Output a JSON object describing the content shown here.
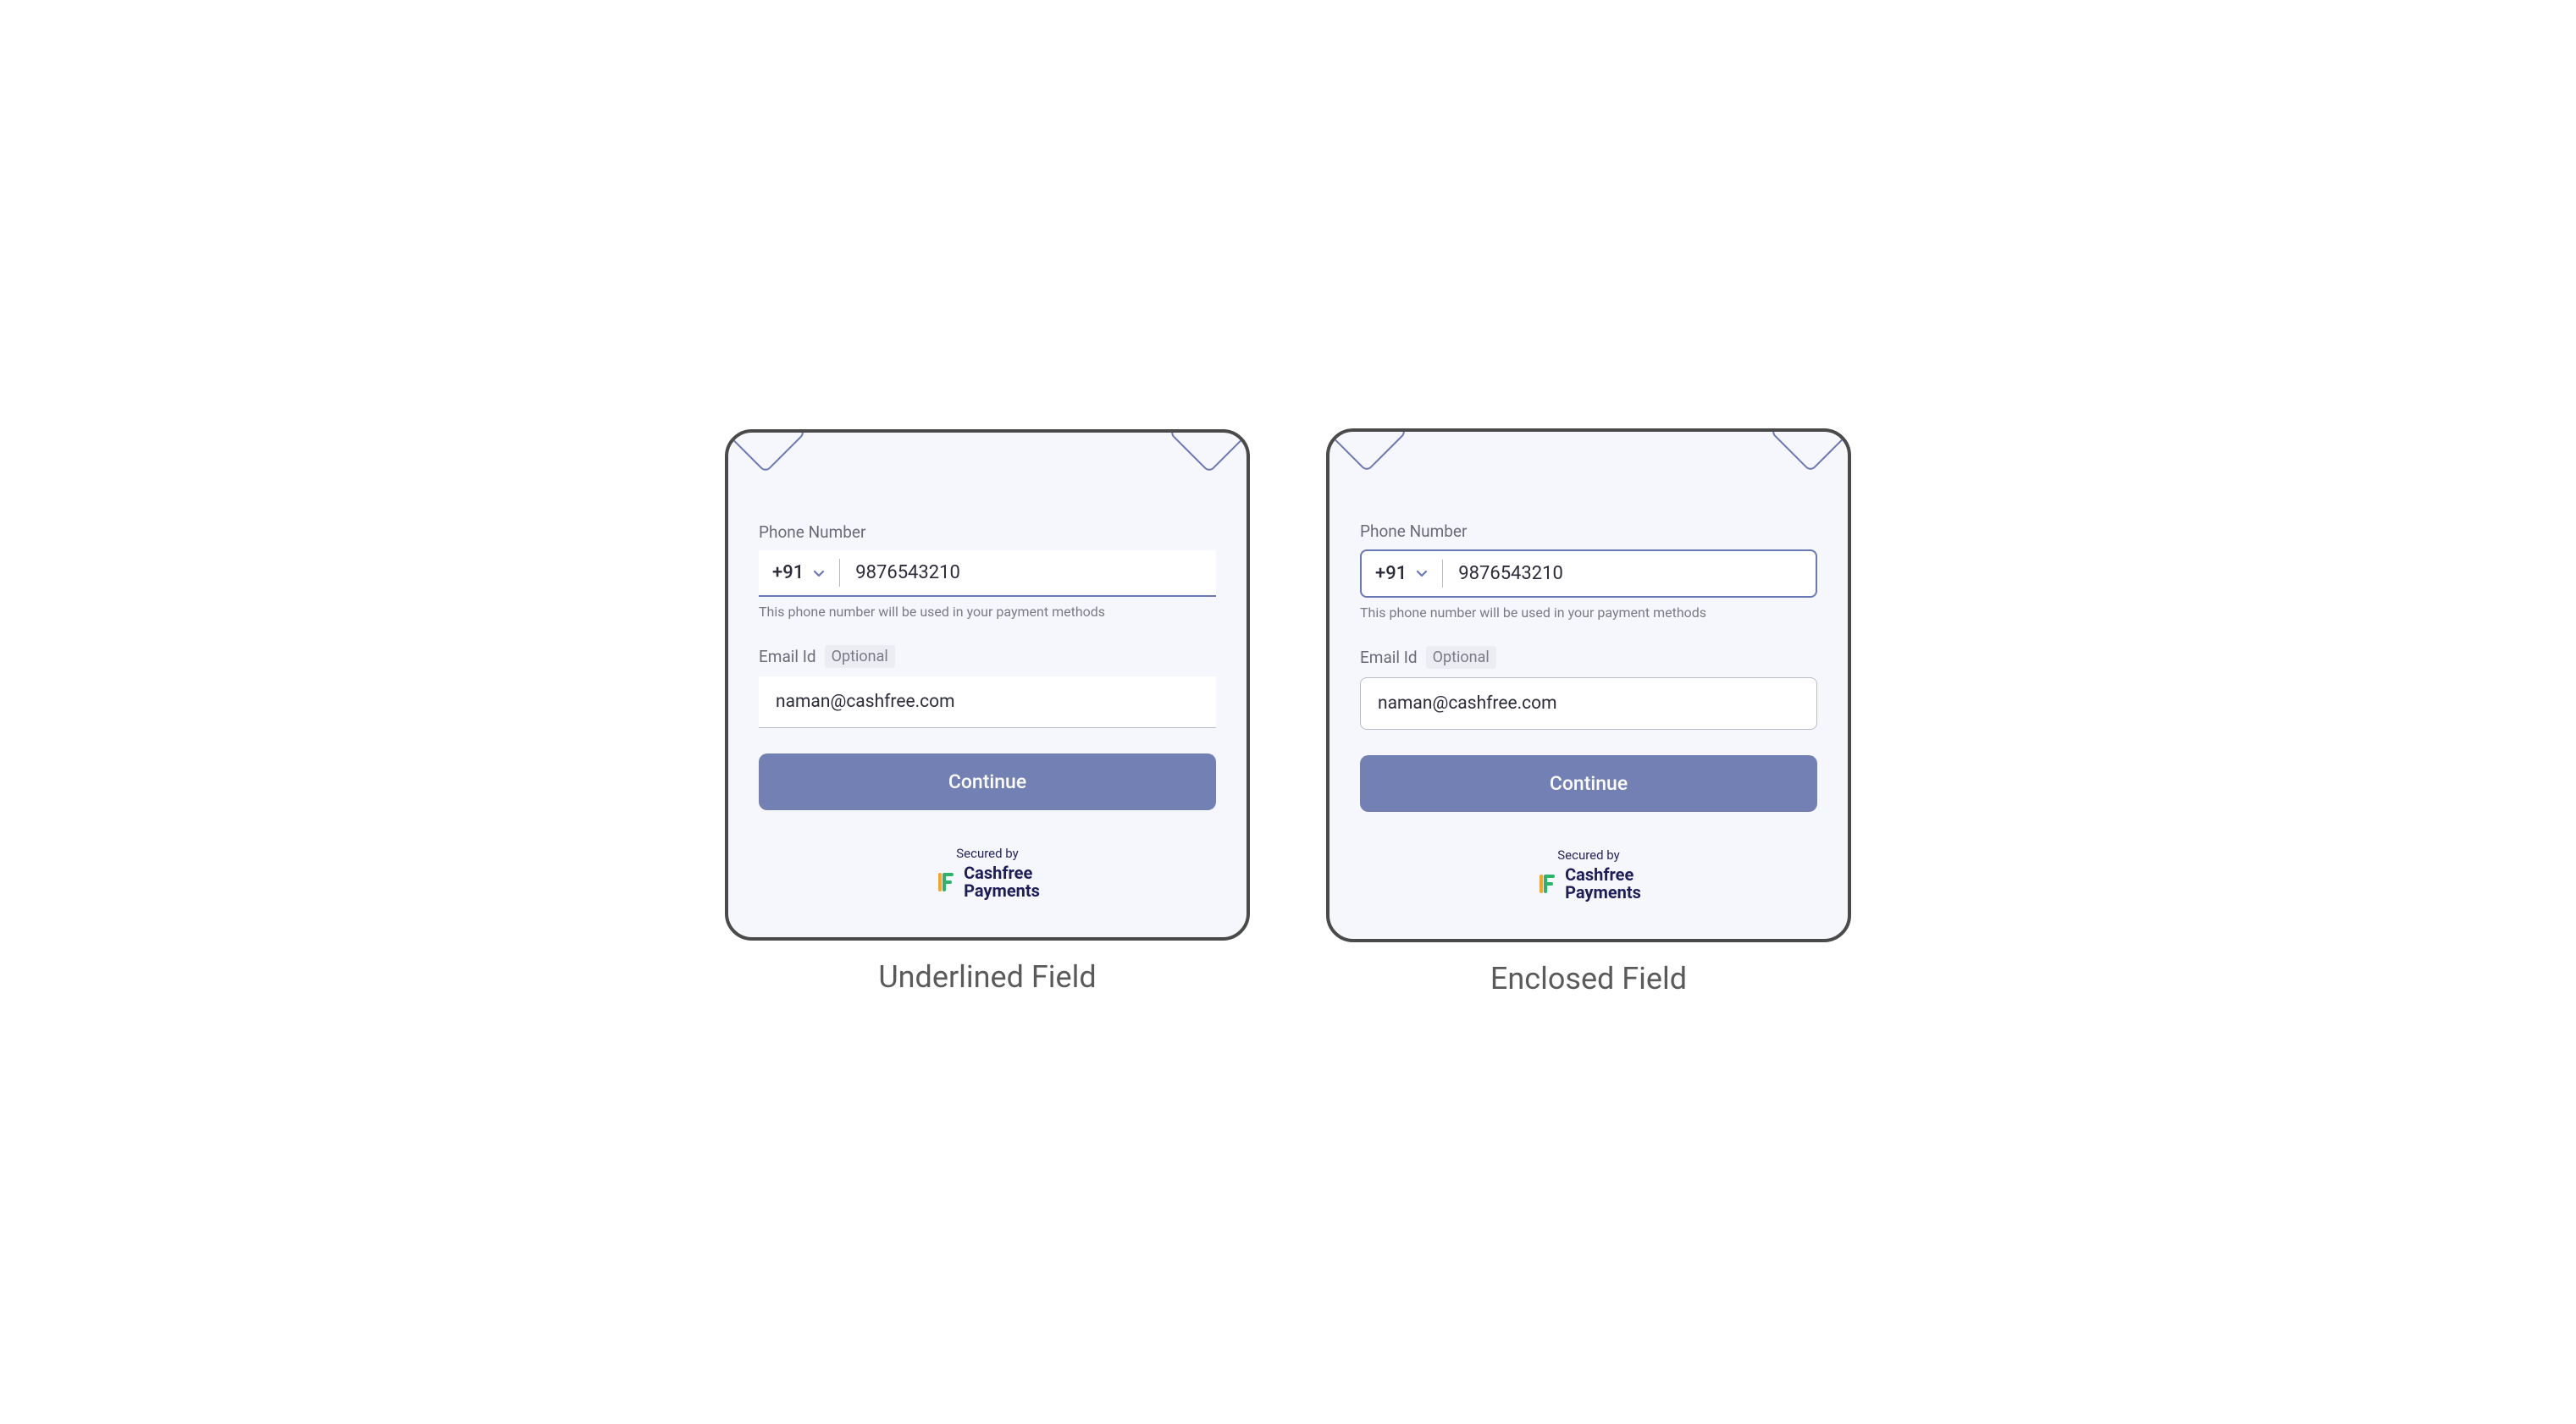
{
  "left": {
    "caption": "Underlined Field",
    "phone_label": "Phone Number",
    "country_code": "+91",
    "phone_value": "9876543210",
    "helper": "This phone number will be used in your payment methods",
    "email_label": "Email Id",
    "optional_badge": "Optional",
    "email_value": "naman@cashfree.com",
    "continue": "Continue",
    "secured": "Secured by",
    "brand_line1": "Cashfree",
    "brand_line2": "Payments"
  },
  "right": {
    "caption": "Enclosed Field",
    "phone_label": "Phone Number",
    "country_code": "+91",
    "phone_value": "9876543210",
    "helper": "This phone number will be used in your payment methods",
    "email_label": "Email Id",
    "optional_badge": "Optional",
    "email_value": "naman@cashfree.com",
    "continue": "Continue",
    "secured": "Secured by",
    "brand_line1": "Cashfree",
    "brand_line2": "Payments"
  }
}
